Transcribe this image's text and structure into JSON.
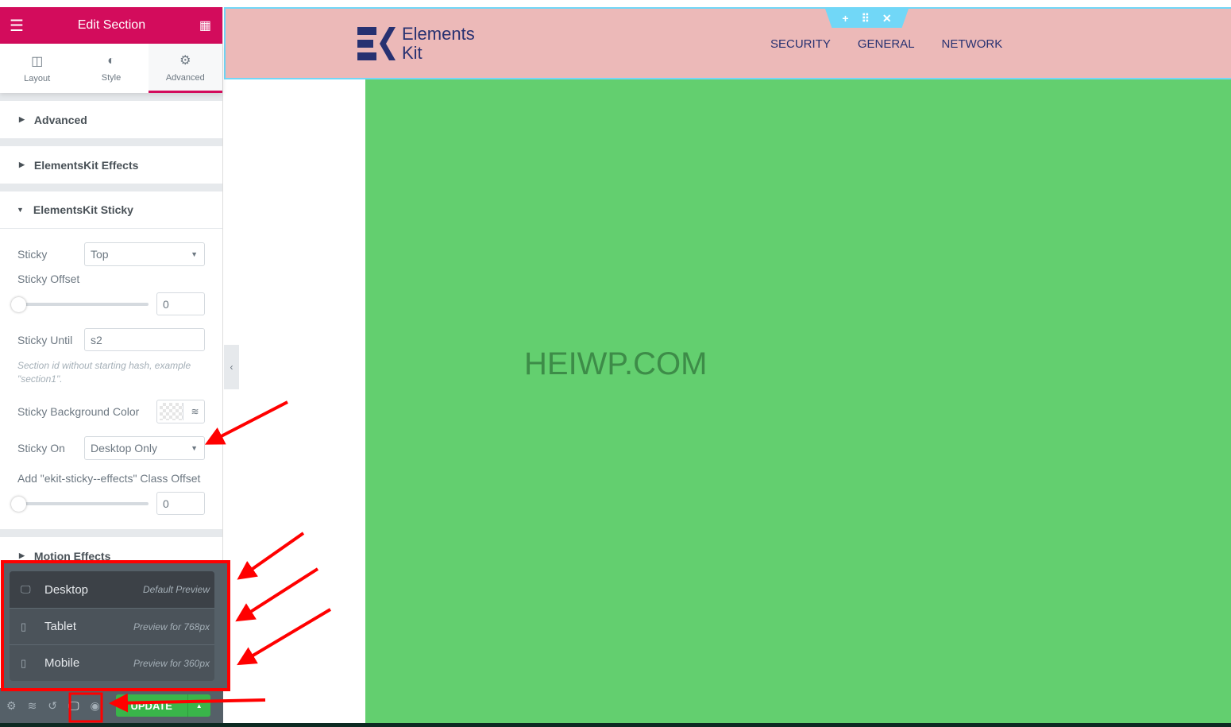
{
  "panel": {
    "title": "Edit Section",
    "tabs": [
      {
        "label": "Layout"
      },
      {
        "label": "Style"
      },
      {
        "label": "Advanced"
      }
    ],
    "sections": [
      {
        "label": "Advanced"
      },
      {
        "label": "ElementsKit Effects"
      },
      {
        "label": "ElementsKit Sticky"
      },
      {
        "label": "Motion Effects"
      }
    ],
    "sticky": {
      "label": "Sticky",
      "value": "Top"
    },
    "sticky_offset": {
      "label": "Sticky Offset",
      "value": "0",
      "slider": 0
    },
    "sticky_until": {
      "label": "Sticky Until",
      "value": "s2",
      "note": "Section id without starting hash, example \"section1\"."
    },
    "sticky_bg": {
      "label": "Sticky Background Color"
    },
    "sticky_on": {
      "label": "Sticky On",
      "value": "Desktop Only"
    },
    "class_offset": {
      "label": "Add \"ekit-sticky--effects\" Class Offset",
      "value": "0",
      "slider": 0
    }
  },
  "devices": [
    {
      "name": "Desktop",
      "hint": "Default Preview",
      "icon": "desktop-icon"
    },
    {
      "name": "Tablet",
      "hint": "Preview for 768px",
      "icon": "tablet-icon"
    },
    {
      "name": "Mobile",
      "hint": "Preview for 360px",
      "icon": "mobile-icon"
    }
  ],
  "footer": {
    "update": "UPDATE"
  },
  "site": {
    "logo_line1": "Elements",
    "logo_line2": "Kit",
    "nav": [
      "SECURITY",
      "GENERAL",
      "NETWORK"
    ],
    "watermark": "HEIWP.COM"
  },
  "colors": {
    "accent": "#d30c5c",
    "header_bg": "#ecb9b8",
    "content_bg": "#63cf6f",
    "update": "#39b54a",
    "annotation": "#ff0000"
  }
}
